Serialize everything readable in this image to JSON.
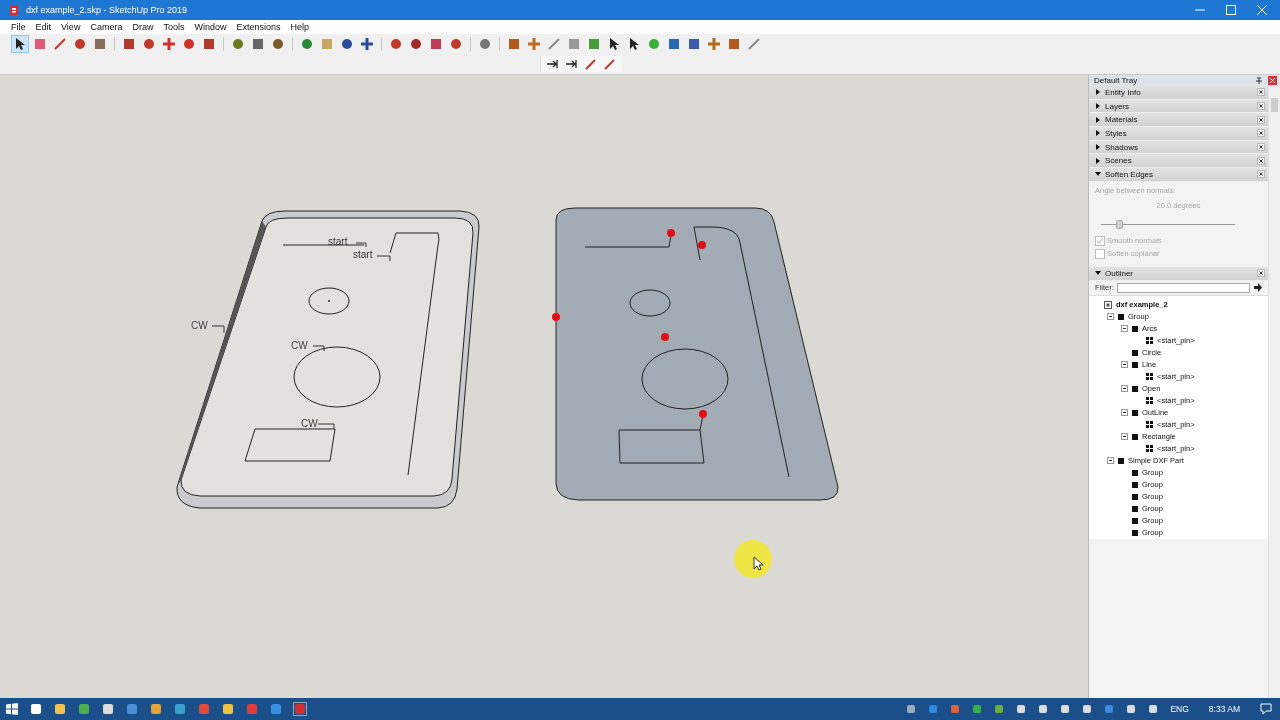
{
  "window": {
    "title": "dxf example_2.skp - SketchUp Pro 2019"
  },
  "menu": [
    "File",
    "Edit",
    "View",
    "Camera",
    "Draw",
    "Tools",
    "Window",
    "Extensions",
    "Help"
  ],
  "canvas": {
    "labels": [
      {
        "text": "start",
        "kind": "start"
      },
      {
        "text": "start",
        "kind": "start"
      },
      {
        "text": "CW",
        "kind": "cw"
      },
      {
        "text": "CW",
        "kind": "cw"
      },
      {
        "text": "CW",
        "kind": "cw"
      }
    ]
  },
  "tray": {
    "title": "Default Tray",
    "panels": [
      {
        "label": "Entity Info",
        "expanded": false
      },
      {
        "label": "Layers",
        "expanded": false
      },
      {
        "label": "Materials",
        "expanded": false
      },
      {
        "label": "Styles",
        "expanded": false
      },
      {
        "label": "Shadows",
        "expanded": false
      },
      {
        "label": "Scenes",
        "expanded": false
      },
      {
        "label": "Soften Edges",
        "expanded": true
      }
    ],
    "soften": {
      "angle_label": "Angle between normals:",
      "angle_value": "20.0  degrees",
      "level": 0.13,
      "options": [
        {
          "label": "Smooth normals",
          "checked": true
        },
        {
          "label": "Soften coplanar",
          "checked": false
        }
      ]
    },
    "outliner": {
      "title": "Outliner",
      "expanded": true,
      "filter_label": "Filter:",
      "tree": [
        {
          "label": "dxf example_2",
          "kind": "model",
          "children": [
            {
              "label": "Group",
              "kind": "group",
              "expanded": true,
              "children": [
                {
                  "label": "Arcs",
                  "kind": "group",
                  "expanded": true,
                  "children": [
                    {
                      "label": "<start_pin>",
                      "kind": "component"
                    }
                  ]
                },
                {
                  "label": "Circle",
                  "kind": "group"
                },
                {
                  "label": "Line",
                  "kind": "group",
                  "expanded": true,
                  "children": [
                    {
                      "label": "<start_pin>",
                      "kind": "component"
                    }
                  ]
                },
                {
                  "label": "Open",
                  "kind": "group",
                  "expanded": true,
                  "children": [
                    {
                      "label": "<start_pin>",
                      "kind": "component"
                    }
                  ]
                },
                {
                  "label": "OutLine",
                  "kind": "group",
                  "expanded": true,
                  "children": [
                    {
                      "label": "<start_pin>",
                      "kind": "component"
                    }
                  ]
                },
                {
                  "label": "Rectangle",
                  "kind": "group",
                  "expanded": true,
                  "children": [
                    {
                      "label": "<start_pin>",
                      "kind": "component"
                    }
                  ]
                }
              ]
            },
            {
              "label": "Simple DXF Part",
              "kind": "group",
              "expanded": true,
              "children": [
                {
                  "label": "Group",
                  "kind": "group"
                },
                {
                  "label": "Group",
                  "kind": "group"
                },
                {
                  "label": "Group",
                  "kind": "group"
                },
                {
                  "label": "Group",
                  "kind": "group"
                },
                {
                  "label": "Group",
                  "kind": "group"
                },
                {
                  "label": "Group",
                  "kind": "group"
                }
              ]
            }
          ]
        }
      ]
    }
  },
  "taskbar": {
    "language": "ENG",
    "time": "8:33 AM"
  }
}
